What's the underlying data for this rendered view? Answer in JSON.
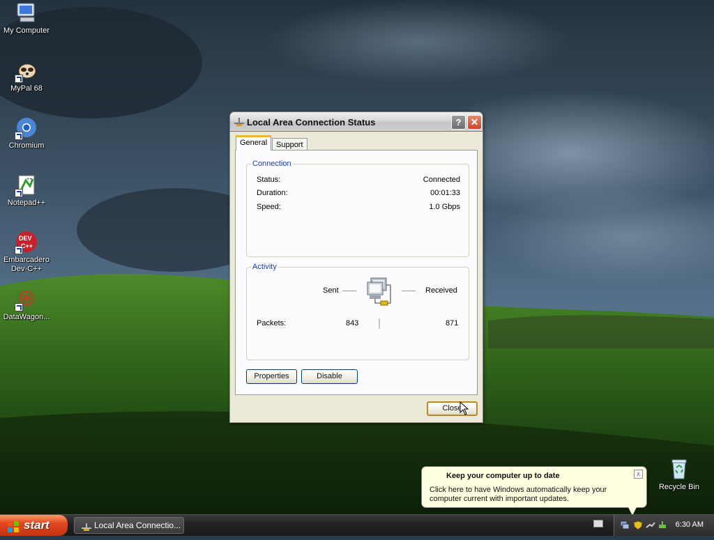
{
  "desktop": {
    "icons": [
      {
        "label": "My Computer",
        "icon": "computer-icon"
      },
      {
        "label": "MyPal 68",
        "icon": "mypal-icon"
      },
      {
        "label": "Chromium",
        "icon": "chromium-icon"
      },
      {
        "label": "Notepad++",
        "icon": "notepadpp-icon"
      },
      {
        "label": "Embarcadero\nDev-C++",
        "icon": "devcpp-icon"
      },
      {
        "label": "DataWagon...",
        "icon": "datawagon-icon"
      },
      {
        "label": "Recycle Bin",
        "icon": "recycle-bin-icon"
      }
    ]
  },
  "dialog": {
    "title": "Local Area Connection Status",
    "help_label": "?",
    "close_label": "✕",
    "tabs": [
      {
        "label": "General",
        "active": true
      },
      {
        "label": "Support",
        "active": false
      }
    ],
    "connection": {
      "group_label": "Connection",
      "rows": [
        {
          "key": "Status:",
          "value": "Connected"
        },
        {
          "key": "Duration:",
          "value": "00:01:33"
        },
        {
          "key": "Speed:",
          "value": "1.0 Gbps"
        }
      ]
    },
    "activity": {
      "group_label": "Activity",
      "sent_label": "Sent",
      "received_label": "Received",
      "packets_label": "Packets:",
      "packets_sent": "843",
      "packets_received": "871"
    },
    "buttons": {
      "properties": "Properties",
      "disable": "Disable",
      "close": "Close"
    }
  },
  "balloon": {
    "title": "Keep your computer up to date",
    "text": "Click here to have Windows automatically keep your computer current with important updates.",
    "close_label": "x"
  },
  "taskbar": {
    "start_label": "start",
    "items": [
      {
        "label": "Local Area Connectio..."
      }
    ],
    "clock": "6:30 AM"
  },
  "colors": {
    "start_button": "#e3471d",
    "taskbar": "#232323",
    "groupbox_label": "#1c3c9c",
    "balloon_bg": "#ffffe1"
  }
}
